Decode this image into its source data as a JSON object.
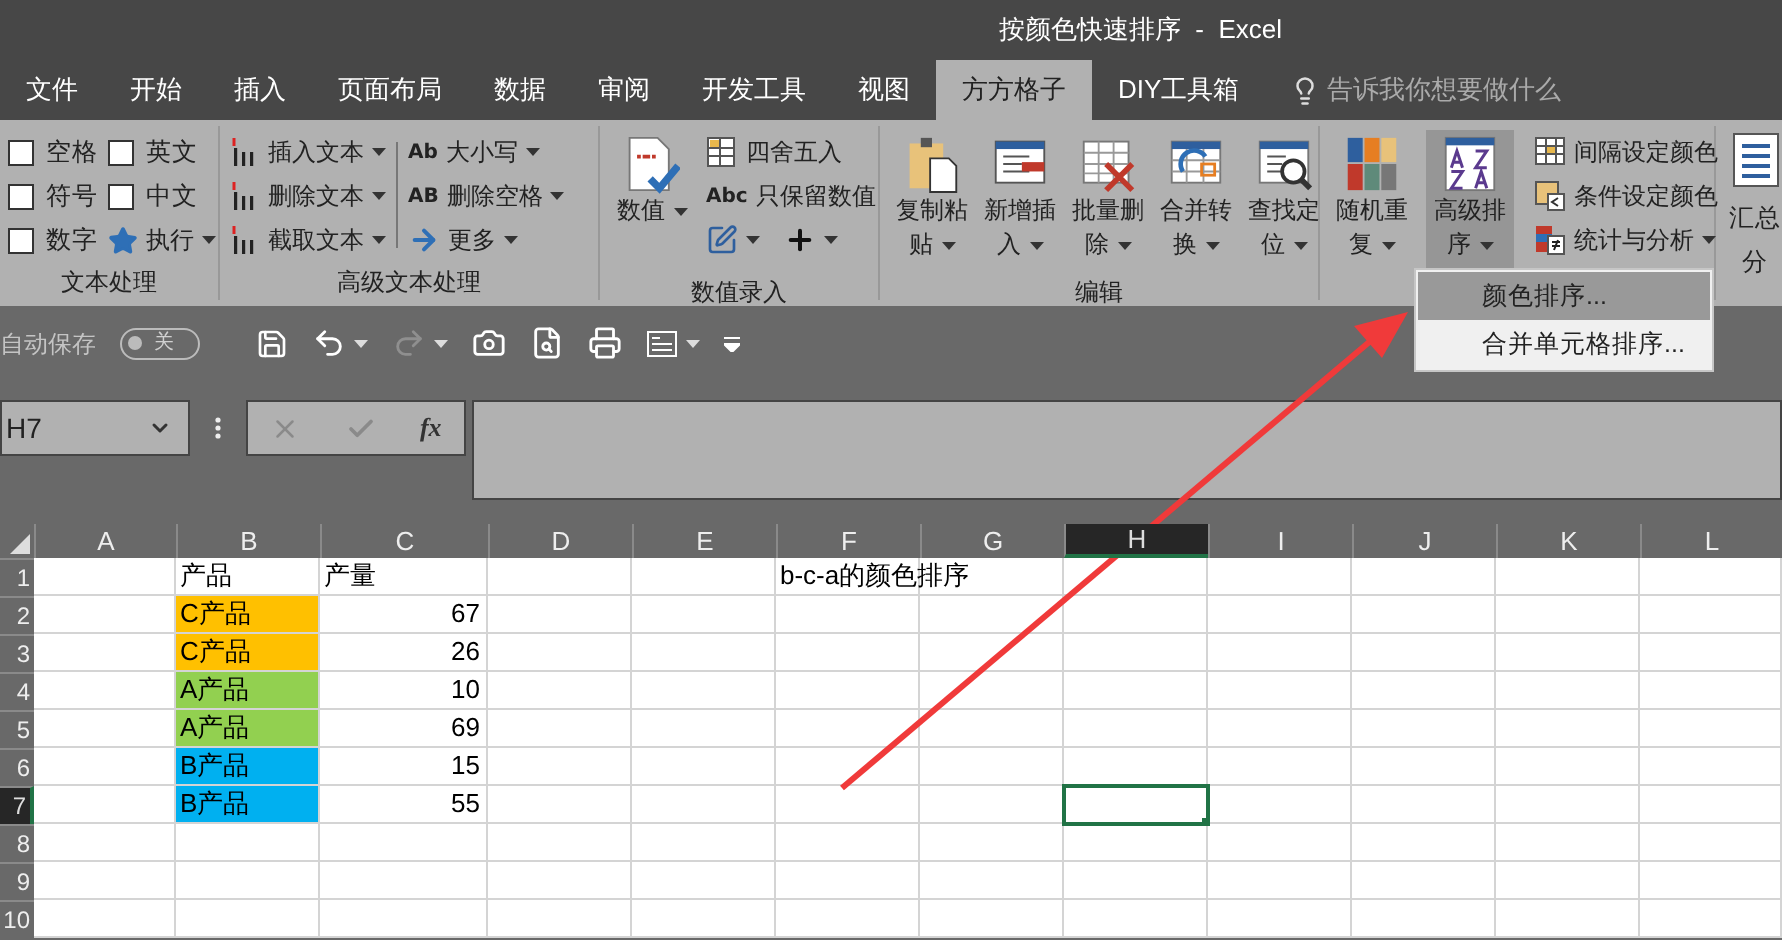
{
  "window": {
    "title": "按颜色快速排序  -  Excel"
  },
  "tabs": [
    {
      "label": "文件",
      "selected": false
    },
    {
      "label": "开始",
      "selected": false
    },
    {
      "label": "插入",
      "selected": false
    },
    {
      "label": "页面布局",
      "selected": false
    },
    {
      "label": "数据",
      "selected": false
    },
    {
      "label": "审阅",
      "selected": false
    },
    {
      "label": "开发工具",
      "selected": false
    },
    {
      "label": "视图",
      "selected": false
    },
    {
      "label": "方方格子",
      "selected": true
    },
    {
      "label": "DIY工具箱",
      "selected": false
    }
  ],
  "tell_me": {
    "placeholder": "告诉我你想要做什么"
  },
  "ribbon": {
    "groups": [
      {
        "label": "文本处理",
        "columns": [
          [
            {
              "kind": "checkbox",
              "label": "空格",
              "checked": false
            },
            {
              "kind": "checkbox",
              "label": "符号",
              "checked": false
            },
            {
              "kind": "checkbox",
              "label": "数字",
              "checked": false
            }
          ],
          [
            {
              "kind": "checkbox",
              "label": "英文",
              "checked": false
            },
            {
              "kind": "checkbox",
              "label": "中文",
              "checked": false
            },
            {
              "kind": "small",
              "label": "执行",
              "dropdown": true
            }
          ]
        ]
      },
      {
        "label": "高级文本处理",
        "columns": [
          [
            {
              "kind": "small",
              "label": "插入文本",
              "dropdown": true
            },
            {
              "kind": "small",
              "label": "删除文本",
              "dropdown": true
            },
            {
              "kind": "small",
              "label": "截取文本",
              "dropdown": true
            }
          ],
          [
            {
              "kind": "small",
              "glyph": "Ab",
              "label": "大小写",
              "dropdown": true
            },
            {
              "kind": "small",
              "glyph": "AB",
              "label": "删除空格",
              "dropdown": true
            },
            {
              "kind": "small",
              "label": "更多",
              "dropdown": true
            }
          ]
        ]
      },
      {
        "label": "数值录入",
        "columns": [
          [
            {
              "kind": "large",
              "label": "数值",
              "dropdown": true,
              "selected": false
            }
          ],
          [
            {
              "kind": "small",
              "label": "四舍五入",
              "dropdown": false
            },
            {
              "kind": "small",
              "glyph": "Abc",
              "label": "只保留数值",
              "dropdown": false
            },
            {
              "kind": "icons",
              "dropdown": true
            }
          ]
        ]
      },
      {
        "label": "编辑",
        "columns": [
          [
            {
              "kind": "large",
              "label": "复制粘贴",
              "dropdown": true,
              "selected": false
            }
          ],
          [
            {
              "kind": "large",
              "label": "新增插入",
              "dropdown": true,
              "selected": false
            }
          ],
          [
            {
              "kind": "large",
              "label": "批量删除",
              "dropdown": true,
              "selected": false
            }
          ],
          [
            {
              "kind": "large",
              "label": "合并转换",
              "dropdown": true,
              "selected": false
            }
          ],
          [
            {
              "kind": "large",
              "label": "查找定位",
              "dropdown": true,
              "selected": false
            }
          ]
        ]
      },
      {
        "columns": [
          [
            {
              "kind": "large",
              "label": "随机重复",
              "dropdown": true,
              "selected": false
            }
          ],
          [
            {
              "kind": "large",
              "label": "高级排序",
              "dropdown": true,
              "selected": true
            }
          ],
          [
            {
              "kind": "small",
              "label": "间隔设定颜色",
              "dropdown": false
            },
            {
              "kind": "small",
              "label": "条件设定颜色",
              "dropdown": false
            },
            {
              "kind": "small",
              "label": "统计与分析",
              "dropdown": true
            }
          ]
        ]
      }
    ],
    "cut_off_item": {
      "label": "汇总分"
    }
  },
  "sort_menu": {
    "items": [
      {
        "label": "颜色排序...",
        "selected": true
      },
      {
        "label": "合并单元格排序...",
        "selected": false
      }
    ]
  },
  "quick_access": {
    "autosave_label": "自动保存",
    "autosave_state": "关",
    "autosave_on": false
  },
  "formula_bar": {
    "name_box": "H7",
    "fx": "fx"
  },
  "sheet": {
    "columns": [
      {
        "label": "A",
        "selected": false
      },
      {
        "label": "B",
        "selected": false
      },
      {
        "label": "C",
        "selected": false
      },
      {
        "label": "D",
        "selected": false
      },
      {
        "label": "E",
        "selected": false
      },
      {
        "label": "F",
        "selected": false
      },
      {
        "label": "G",
        "selected": false
      },
      {
        "label": "H",
        "selected": true
      },
      {
        "label": "I",
        "selected": false
      },
      {
        "label": "J",
        "selected": false
      },
      {
        "label": "K",
        "selected": false
      },
      {
        "label": "L",
        "selected": false
      }
    ],
    "rows": [
      {
        "number": "1",
        "selected": false,
        "product": {
          "text": "产品"
        },
        "output": "产量",
        "note": "b-c-a的颜色排序"
      },
      {
        "number": "2",
        "selected": false,
        "product": {
          "text": "C产品",
          "color": "#ffc000"
        },
        "output": "67"
      },
      {
        "number": "3",
        "selected": false,
        "product": {
          "text": "C产品",
          "color": "#ffc000"
        },
        "output": "26"
      },
      {
        "number": "4",
        "selected": false,
        "product": {
          "text": "A产品",
          "color": "#92d050"
        },
        "output": "10"
      },
      {
        "number": "5",
        "selected": false,
        "product": {
          "text": "A产品",
          "color": "#92d050"
        },
        "output": "69"
      },
      {
        "number": "6",
        "selected": false,
        "product": {
          "text": "B产品",
          "color": "#00b0f0"
        },
        "output": "15"
      },
      {
        "number": "7",
        "selected": true,
        "product": {
          "text": "B产品",
          "color": "#00b0f0"
        },
        "output": "55"
      },
      {
        "number": "8",
        "selected": false
      },
      {
        "number": "9",
        "selected": false
      },
      {
        "number": "10",
        "selected": false
      }
    ]
  }
}
